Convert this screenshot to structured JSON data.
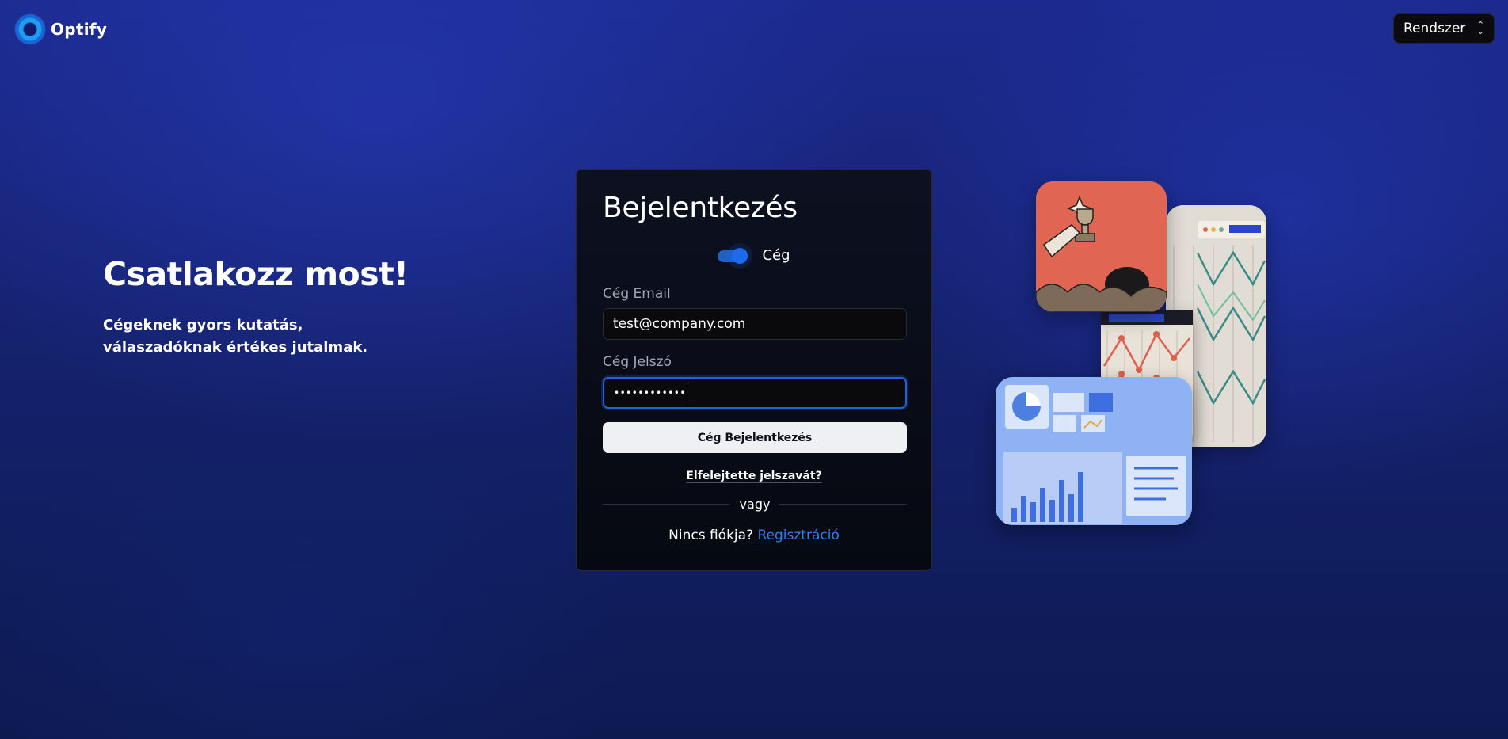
{
  "header": {
    "brand": "Optify",
    "theme_select": "Rendszer"
  },
  "hero": {
    "title": "Csatlakozz most!",
    "subtitle": "Cégeknek gyors kutatás, válaszadóknak értékes jutalmak."
  },
  "login": {
    "title": "Bejelentkezés",
    "toggle_label": "Cég",
    "toggle_on": true,
    "email_label": "Cég Email",
    "email_value": "test@company.com",
    "password_label": "Cég Jelszó",
    "password_value": "••••••••••••",
    "submit_label": "Cég Bejelentkezés",
    "forgot_link": "Elfelejtette jelszavát?",
    "divider_text": "vagy",
    "signup_prompt": "Nincs fiókja?",
    "signup_link": "Regisztráció"
  },
  "colors": {
    "accent": "#1b6bf0",
    "link": "#2f7ff0",
    "background": "#1c2a8f"
  },
  "icons": {
    "logo": "optify-logo-icon",
    "select_chevron": "chevron-up-down-icon"
  }
}
